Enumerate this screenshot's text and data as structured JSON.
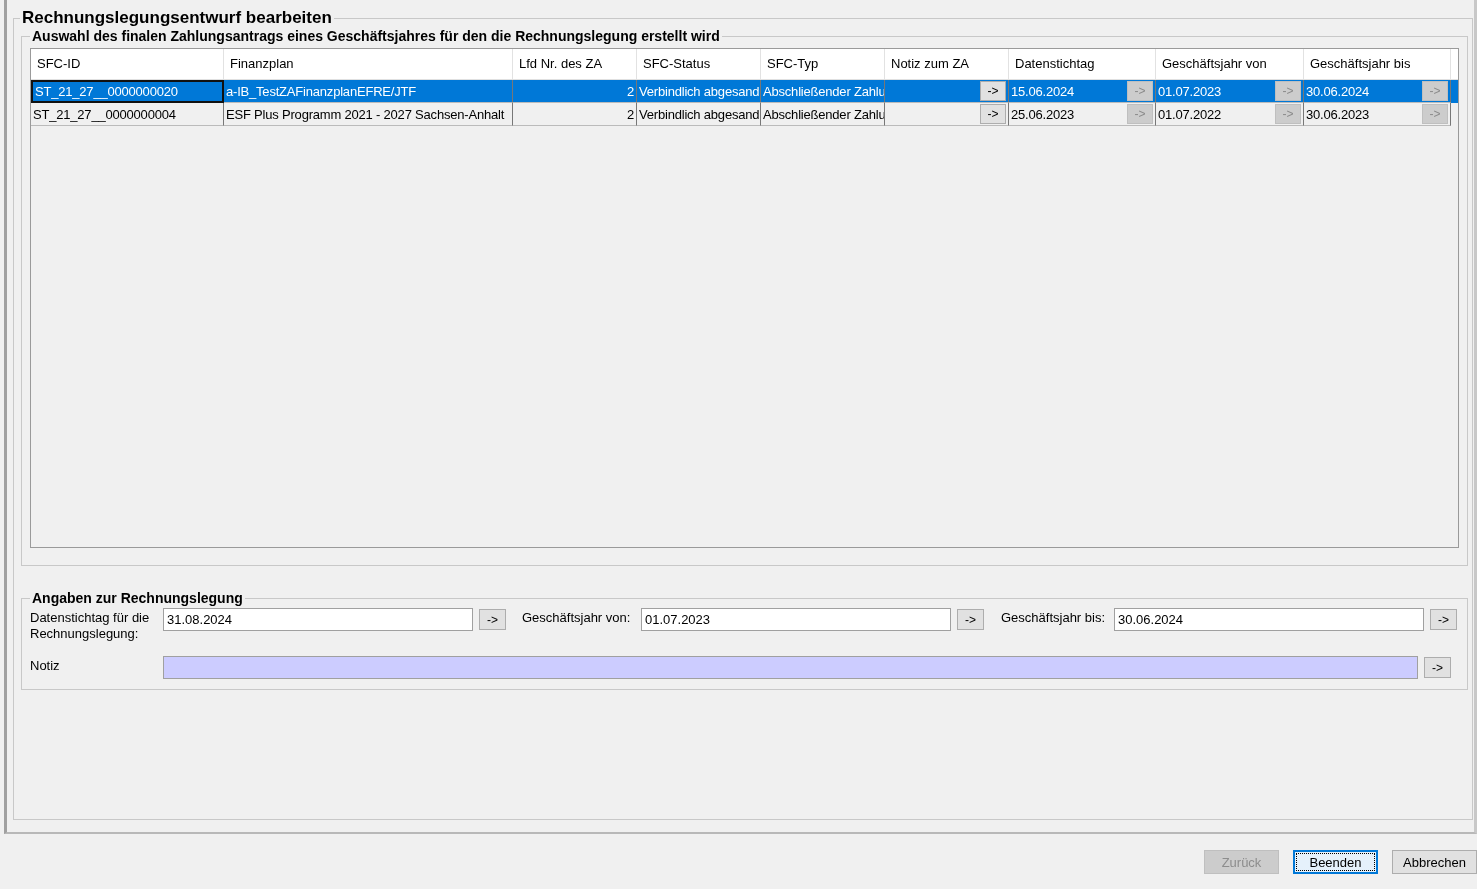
{
  "title": "Rechnungslegungsentwurf bearbeiten",
  "selection": {
    "title": "Auswahl des finalen Zahlungsantrags eines Geschäftsjahres für den die Rechnungslegung erstellt wird",
    "columns": [
      "SFC-ID",
      "Finanzplan",
      "Lfd Nr. des ZA",
      "SFC-Status",
      "SFC-Typ",
      "Notiz zum ZA",
      "Datenstichtag",
      "Geschäftsjahr von",
      "Geschäftsjahr bis"
    ],
    "rows": [
      {
        "selected": true,
        "cells": [
          {
            "text": "ST_21_27__0000000020"
          },
          {
            "text": "a-IB_TestZAFinanzplanEFRE/JTF"
          },
          {
            "text": "2"
          },
          {
            "text": "Verbindlich abgesand"
          },
          {
            "text": "Abschließender Zahlu"
          },
          {
            "button": {
              "label": "->",
              "disabled": false
            }
          },
          {
            "text": "15.06.2024",
            "button": {
              "label": "->",
              "disabled": true
            }
          },
          {
            "text": "01.07.2023",
            "button": {
              "label": "->",
              "disabled": true
            }
          },
          {
            "text": "30.06.2024",
            "button": {
              "label": "->",
              "disabled": true
            }
          }
        ]
      },
      {
        "selected": false,
        "cells": [
          {
            "text": "ST_21_27__0000000004"
          },
          {
            "text": "ESF Plus Programm 2021 - 2027 Sachsen-Anhalt"
          },
          {
            "text": "2"
          },
          {
            "text": "Verbindlich abgesand"
          },
          {
            "text": "Abschließender Zahlu"
          },
          {
            "button": {
              "label": "->",
              "disabled": false
            }
          },
          {
            "text": "25.06.2023",
            "button": {
              "label": "->",
              "disabled": true
            }
          },
          {
            "text": "01.07.2022",
            "button": {
              "label": "->",
              "disabled": true
            }
          },
          {
            "text": "30.06.2023",
            "button": {
              "label": "->",
              "disabled": true
            }
          }
        ]
      }
    ]
  },
  "details": {
    "title": "Angaben zur Rechnungslegung",
    "fields": [
      {
        "label": "Datenstichtag für die Rechnungslegung:",
        "value": "31.08.2024",
        "button": "->"
      },
      {
        "label": "Geschäftsjahr von:",
        "value": "01.07.2023",
        "button": "->"
      },
      {
        "label": "Geschäftsjahr bis:",
        "value": "30.06.2024",
        "button": "->"
      }
    ],
    "note": {
      "label": "Notiz",
      "button": "->"
    }
  },
  "buttons": [
    {
      "label": "Zurück",
      "disabled": true,
      "default": false
    },
    {
      "label": "Beenden",
      "disabled": false,
      "default": true
    },
    {
      "label": "Abbrechen",
      "disabled": false,
      "default": false
    }
  ]
}
